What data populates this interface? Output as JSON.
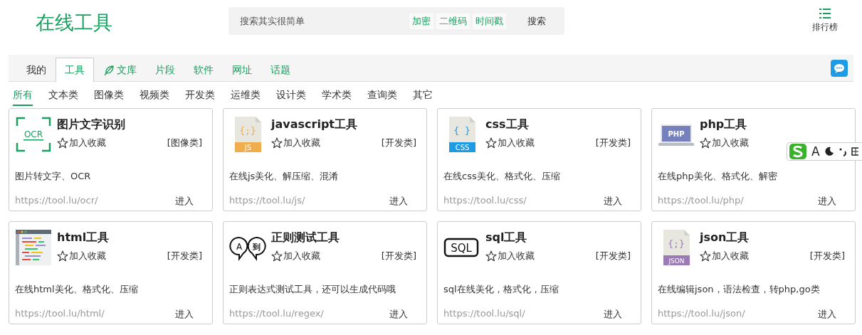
{
  "header": {
    "logo": "在线工具",
    "search": {
      "placeholder": "搜索其实很简单",
      "tags": [
        "加密",
        "二维码",
        "时间戳"
      ],
      "button": "搜索"
    },
    "ranking": "排行榜"
  },
  "nav_tabs": [
    {
      "label": "我的",
      "kind": "personal",
      "selected": false
    },
    {
      "label": "工具",
      "kind": "section",
      "selected": true
    },
    {
      "label": "文库",
      "kind": "leaf",
      "selected": false
    },
    {
      "label": "片段",
      "kind": "section",
      "selected": false
    },
    {
      "label": "软件",
      "kind": "section",
      "selected": false
    },
    {
      "label": "网址",
      "kind": "section",
      "selected": false
    },
    {
      "label": "话题",
      "kind": "section",
      "selected": false
    }
  ],
  "categories": [
    {
      "label": "所有",
      "selected": true
    },
    {
      "label": "文本类",
      "selected": false
    },
    {
      "label": "图像类",
      "selected": false
    },
    {
      "label": "视频类",
      "selected": false
    },
    {
      "label": "开发类",
      "selected": false
    },
    {
      "label": "运维类",
      "selected": false
    },
    {
      "label": "设计类",
      "selected": false
    },
    {
      "label": "学术类",
      "selected": false
    },
    {
      "label": "查询类",
      "selected": false
    },
    {
      "label": "其它",
      "selected": false
    }
  ],
  "cards": [
    {
      "title": "图片文字识别",
      "icon": {
        "kind": "ocr",
        "labels": [
          "OCR"
        ]
      },
      "favorite": "加入收藏",
      "category": "[图像类]",
      "description": "图片转文字、OCR",
      "url": "https://tool.lu/ocr/",
      "enter": "进入"
    },
    {
      "title": "javascript工具",
      "icon": {
        "kind": "js",
        "labels": [
          "{;}",
          "JS"
        ]
      },
      "favorite": "加入收藏",
      "category": "[开发类]",
      "description": "在线js美化、解压缩、混淆",
      "url": "https://tool.lu/js/",
      "enter": "进入"
    },
    {
      "title": "css工具",
      "icon": {
        "kind": "css",
        "labels": [
          "{ }",
          "CSS"
        ]
      },
      "favorite": "加入收藏",
      "category": "[开发类]",
      "description": "在线css美化、格式化、压缩",
      "url": "https://tool.lu/css/",
      "enter": "进入"
    },
    {
      "title": "php工具",
      "icon": {
        "kind": "php",
        "labels": [
          "PHP"
        ]
      },
      "favorite": "加入收藏",
      "description": "在线php美化、格式化、解密",
      "url": "https://tool.lu/php/",
      "enter": "进入"
    },
    {
      "title": "html工具",
      "icon": {
        "kind": "html"
      },
      "favorite": "加入收藏",
      "category": "[开发类]",
      "description": "在线html美化、格式化、压缩",
      "url": "https://tool.lu/html/",
      "enter": "进入"
    },
    {
      "title": "正则测试工具",
      "icon": {
        "kind": "regex",
        "labels": [
          "A",
          "到"
        ]
      },
      "favorite": "加入收藏",
      "category": "[开发类]",
      "description": "正则表达式测试工具，还可以生成代码哦",
      "url": "https://tool.lu/regex/",
      "enter": "进入"
    },
    {
      "title": "sql工具",
      "icon": {
        "kind": "sql",
        "labels": [
          "SQL"
        ]
      },
      "favorite": "加入收藏",
      "category": "[开发类]",
      "description": "sql在线美化，格式化，压缩",
      "url": "https://tool.lu/sql/",
      "enter": "进入"
    },
    {
      "title": "json工具",
      "icon": {
        "kind": "json",
        "labels": [
          "{;}",
          "JSON"
        ]
      },
      "favorite": "加入收藏",
      "category": "[开发类]",
      "description": "在线编辑json，语法检查，转php,go类",
      "url": "https://tool.lu/json/",
      "enter": "进入"
    }
  ],
  "ime_toolbar": {
    "label": "A"
  }
}
